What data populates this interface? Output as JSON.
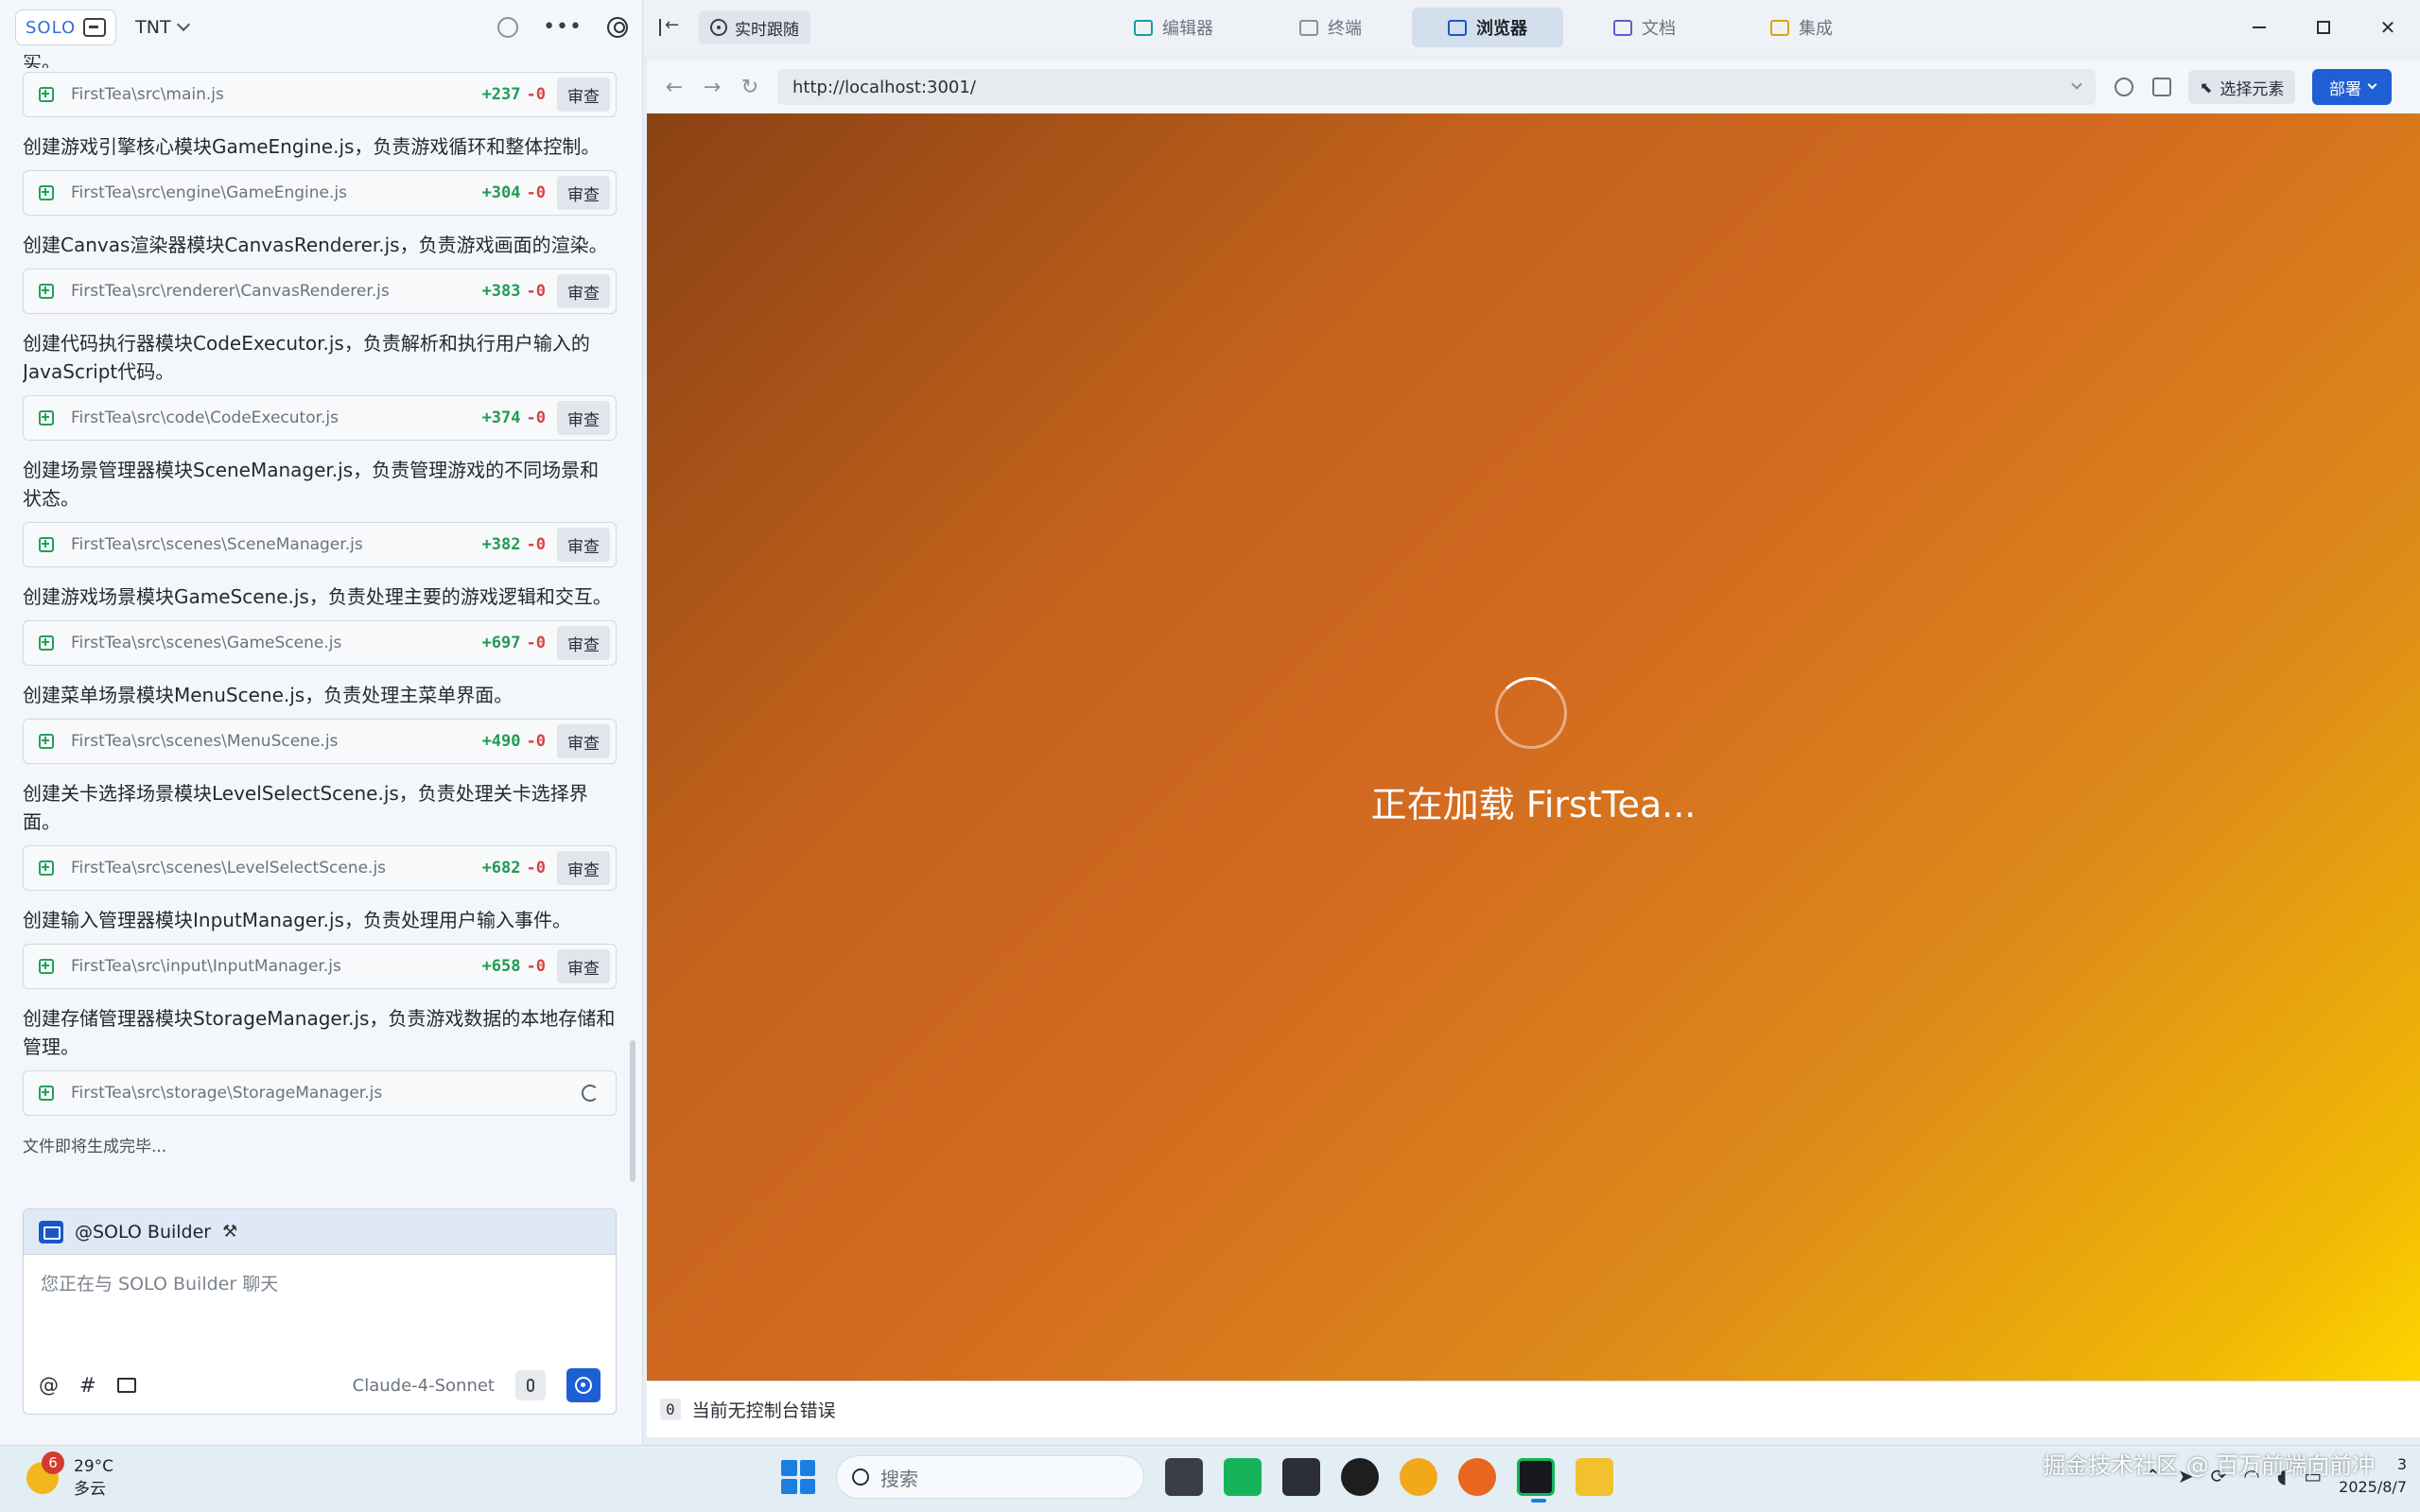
{
  "left_panel": {
    "solo_label": "SOLO",
    "project_name": "TNT",
    "partial_top_text": "实。",
    "entries": [
      {
        "message": "",
        "file": "FirstTea\\src\\main.js",
        "add": "+237",
        "del": "-0",
        "review": "审查"
      },
      {
        "message": "创建游戏引擎核心模块GameEngine.js，负责游戏循环和整体控制。",
        "file": "FirstTea\\src\\engine\\GameEngine.js",
        "add": "+304",
        "del": "-0",
        "review": "审查"
      },
      {
        "message": "创建Canvas渲染器模块CanvasRenderer.js，负责游戏画面的渲染。",
        "file": "FirstTea\\src\\renderer\\CanvasRenderer.js",
        "add": "+383",
        "del": "-0",
        "review": "审查"
      },
      {
        "message": "创建代码执行器模块CodeExecutor.js，负责解析和执行用户输入的JavaScript代码。",
        "file": "FirstTea\\src\\code\\CodeExecutor.js",
        "add": "+374",
        "del": "-0",
        "review": "审查"
      },
      {
        "message": "创建场景管理器模块SceneManager.js，负责管理游戏的不同场景和状态。",
        "file": "FirstTea\\src\\scenes\\SceneManager.js",
        "add": "+382",
        "del": "-0",
        "review": "审查"
      },
      {
        "message": "创建游戏场景模块GameScene.js，负责处理主要的游戏逻辑和交互。",
        "file": "FirstTea\\src\\scenes\\GameScene.js",
        "add": "+697",
        "del": "-0",
        "review": "审查"
      },
      {
        "message": "创建菜单场景模块MenuScene.js，负责处理主菜单界面。",
        "file": "FirstTea\\src\\scenes\\MenuScene.js",
        "add": "+490",
        "del": "-0",
        "review": "审查"
      },
      {
        "message": "创建关卡选择场景模块LevelSelectScene.js，负责处理关卡选择界面。",
        "file": "FirstTea\\src\\scenes\\LevelSelectScene.js",
        "add": "+682",
        "del": "-0",
        "review": "审查"
      },
      {
        "message": "创建输入管理器模块InputManager.js，负责处理用户输入事件。",
        "file": "FirstTea\\src\\input\\InputManager.js",
        "add": "+658",
        "del": "-0",
        "review": "审查"
      }
    ],
    "pending_entry": {
      "message": "创建存储管理器模块StorageManager.js，负责游戏数据的本地存储和管理。",
      "file": "FirstTea\\src\\storage\\StorageManager.js"
    },
    "status_note": "文件即将生成完毕...",
    "chat": {
      "agent": "@SOLO Builder",
      "placeholder": "您正在与 SOLO Builder 聊天",
      "at_symbol": "@",
      "hash_symbol": "#",
      "model": "Claude-4-Sonnet"
    }
  },
  "app_topbar": {
    "live_follow": "实时跟随",
    "tabs": [
      {
        "label": "编辑器",
        "icon": "editor-icon",
        "active": false
      },
      {
        "label": "终端",
        "icon": "terminal-icon",
        "active": false
      },
      {
        "label": "浏览器",
        "icon": "browser-icon",
        "active": true
      },
      {
        "label": "文档",
        "icon": "docs-icon",
        "active": false
      },
      {
        "label": "集成",
        "icon": "integration-icon",
        "active": false
      }
    ]
  },
  "browser": {
    "url": "http://localhost:3001/",
    "select_element": "选择元素",
    "deploy": "部署",
    "loading_text": "正在加载 FirstTea...",
    "console_count": "0",
    "console_text": "当前无控制台错误"
  },
  "taskbar": {
    "weather_badge": "6",
    "temperature": "29°C",
    "weather_desc": "多云",
    "search_placeholder": "搜索",
    "time": "3",
    "date": "2025/8/7",
    "watermark": "掘金技术社区 @ 百万前端向前冲"
  },
  "colors": {
    "accent": "#1f5fd4",
    "diff_add": "#1f9c52",
    "diff_del": "#d24545",
    "gradient_start": "#8a4214",
    "gradient_end": "#ffd400"
  }
}
